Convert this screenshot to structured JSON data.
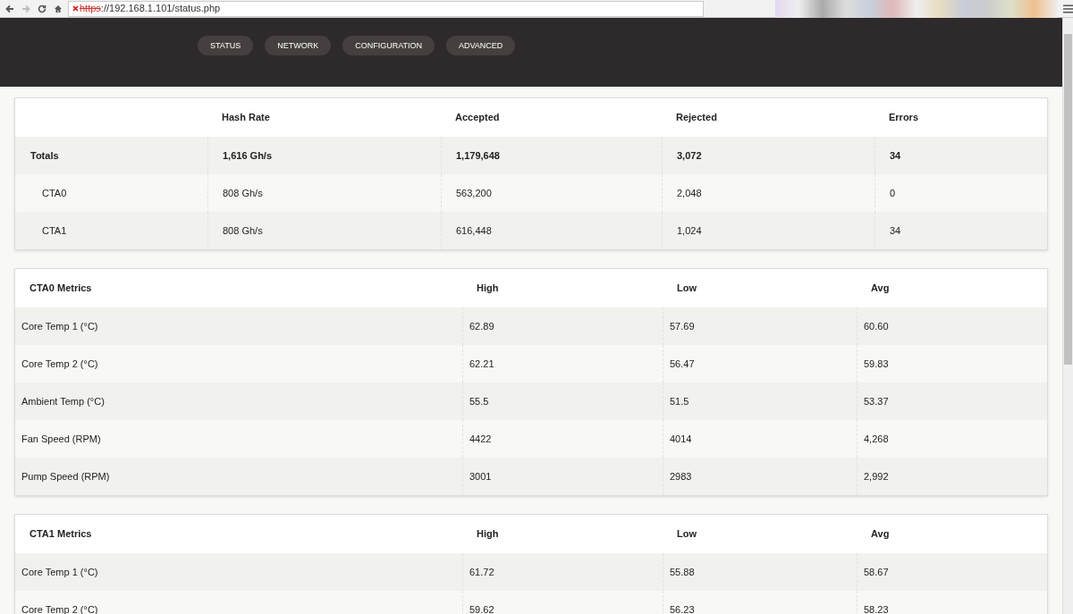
{
  "browser": {
    "url_scheme": "https",
    "url_rest": "://192.168.1.101/status.php"
  },
  "nav": [
    {
      "label": "STATUS"
    },
    {
      "label": "NETWORK"
    },
    {
      "label": "CONFIGURATION"
    },
    {
      "label": "ADVANCED"
    }
  ],
  "totals_table": {
    "columns": [
      "",
      "Hash Rate",
      "Accepted",
      "Rejected",
      "Errors"
    ],
    "rows": [
      {
        "kind": "total",
        "cells": [
          "Totals",
          "1,616 Gh/s",
          "1,179,648",
          "3,072",
          "34"
        ]
      },
      {
        "kind": "unit",
        "cells": [
          "CTA0",
          "808 Gh/s",
          "563,200",
          "2,048",
          "0"
        ]
      },
      {
        "kind": "unit",
        "cells": [
          "CTA1",
          "808 Gh/s",
          "616,448",
          "1,024",
          "34"
        ]
      }
    ]
  },
  "metrics_tables": [
    {
      "columns": [
        "CTA0 Metrics",
        "High",
        "Low",
        "Avg"
      ],
      "rows": [
        [
          "Core Temp 1 (°C)",
          "62.89",
          "57.69",
          "60.60"
        ],
        [
          "Core Temp 2 (°C)",
          "62.21",
          "56.47",
          "59.83"
        ],
        [
          "Ambient Temp (°C)",
          "55.5",
          "51.5",
          "53.37"
        ],
        [
          "Fan Speed (RPM)",
          "4422",
          "4014",
          "4,268"
        ],
        [
          "Pump Speed (RPM)",
          "3001",
          "2983",
          "2,992"
        ]
      ]
    },
    {
      "columns": [
        "CTA1 Metrics",
        "High",
        "Low",
        "Avg"
      ],
      "rows": [
        [
          "Core Temp 1 (°C)",
          "61.72",
          "55.88",
          "58.67"
        ],
        [
          "Core Temp 2 (°C)",
          "59.62",
          "56.23",
          "58.23"
        ]
      ]
    }
  ]
}
